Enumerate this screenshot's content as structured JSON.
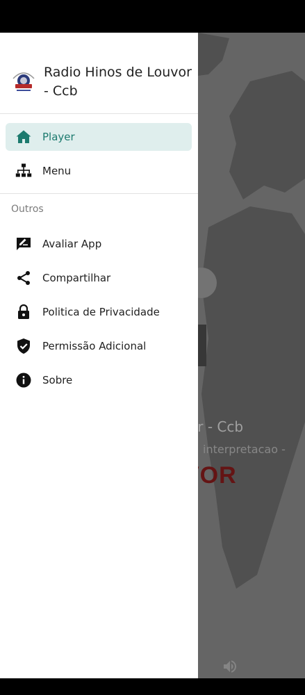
{
  "drawer": {
    "app_title": "Radio Hinos de Louvor - Ccb",
    "logo_icon": "radio-logo",
    "primary_items": [
      {
        "label": "Player",
        "icon": "home-icon",
        "active": true
      },
      {
        "label": "Menu",
        "icon": "sitemap-icon",
        "active": false
      }
    ],
    "section_label": "Outros",
    "other_items": [
      {
        "label": "Avaliar App",
        "icon": "rate-review-icon"
      },
      {
        "label": "Compartilhar",
        "icon": "share-icon"
      },
      {
        "label": "Politica de Privacidade",
        "icon": "lock-icon"
      },
      {
        "label": "Permissão Adicional",
        "icon": "shield-check-icon"
      },
      {
        "label": "Sobre",
        "icon": "info-icon"
      }
    ]
  },
  "background": {
    "title_fragment": "or - Ccb",
    "subtitle_fragment": "interpretacao -",
    "logo_fragment": "VOR",
    "volume_icon": "volume-icon"
  },
  "colors": {
    "accent": "#1c7a6e",
    "active_background": "#dfeeed"
  }
}
